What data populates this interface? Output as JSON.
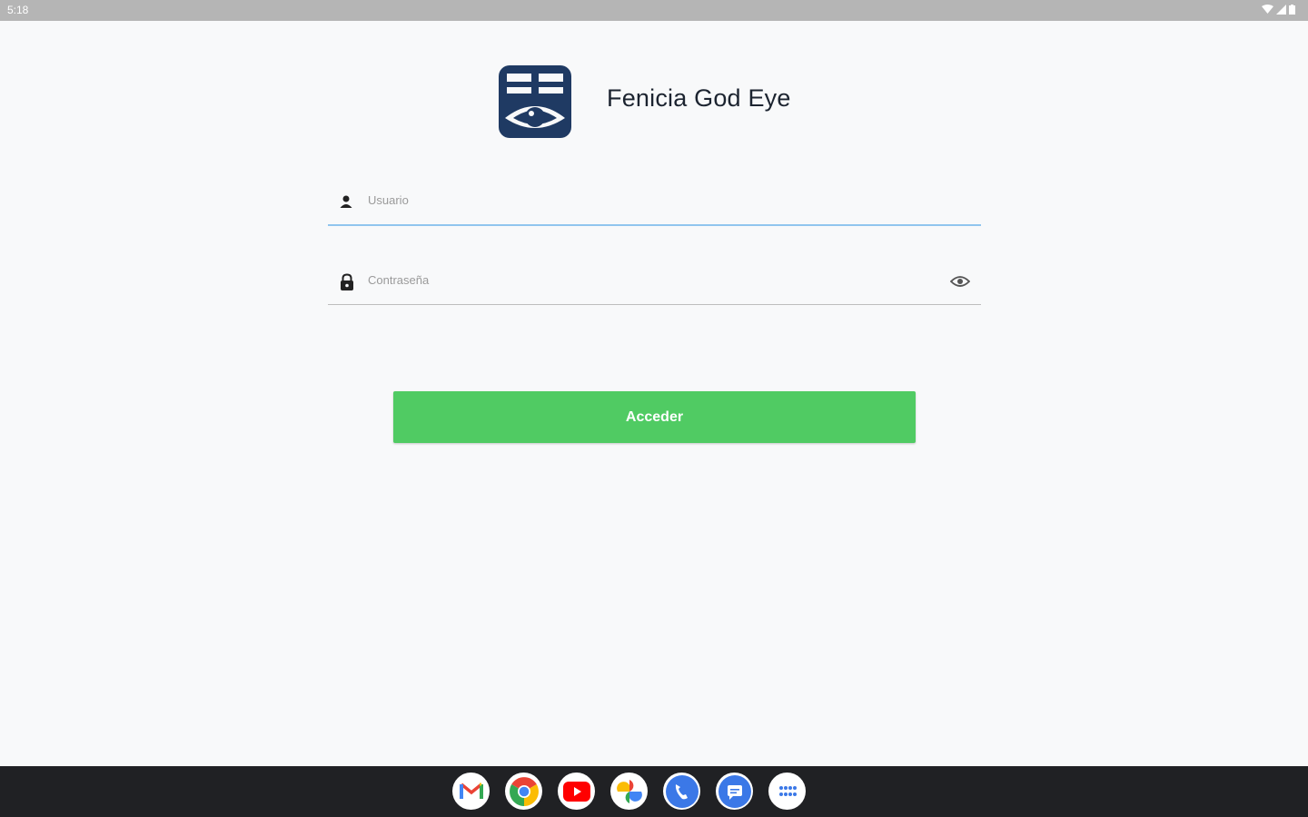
{
  "status_bar": {
    "time": "5:18"
  },
  "app": {
    "title": "Fenicia God Eye",
    "logo_icon": "fenicia-eye-logo"
  },
  "login": {
    "username_placeholder": "Usuario",
    "password_placeholder": "Contraseña",
    "submit_label": "Acceder",
    "submit_color": "#50cb63",
    "active_field_underline": "#90c5ee"
  },
  "taskbar": {
    "apps": [
      "gmail",
      "chrome",
      "youtube",
      "photos",
      "phone",
      "messages",
      "app-drawer"
    ]
  }
}
